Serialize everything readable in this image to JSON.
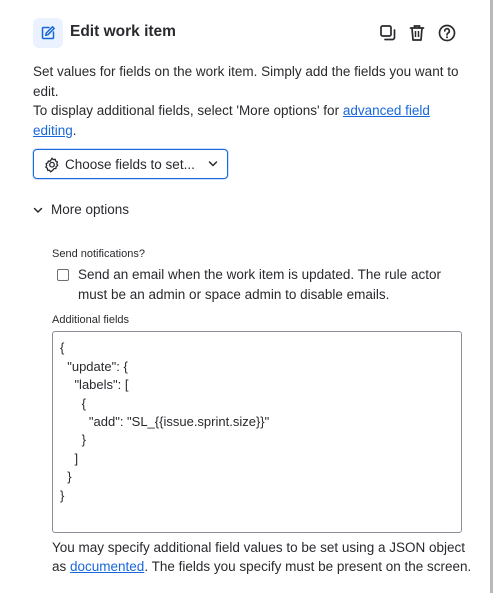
{
  "header": {
    "title": "Edit work item",
    "icons": [
      "edit-icon",
      "copy-icon",
      "trash-icon",
      "help-icon"
    ]
  },
  "description": {
    "line1": "Set values for fields on the work item. Simply add the fields you want to edit.",
    "line2_prefix": "To display additional fields, select 'More options' for ",
    "line2_link": "advanced field editing",
    "line2_suffix": "."
  },
  "choose_fields": {
    "label": "Choose fields to set...",
    "icon": "gear-icon"
  },
  "more_options": {
    "label": "More options",
    "expanded": true
  },
  "notifications": {
    "label": "Send notifications?",
    "checkbox_text": "Send an email when the work item is updated. The rule actor must be an admin or space admin to disable emails.",
    "checked": false
  },
  "additional_fields": {
    "label": "Additional fields",
    "lines": [
      "{",
      "  \"update\": {",
      "    \"labels\": [",
      "      {",
      "        \"add\": \"SL_{{issue.sprint.size}}\"",
      "      }",
      "    ]",
      "  }",
      "}"
    ]
  },
  "help_text": {
    "prefix": "You may specify additional field values to be set using a JSON object as ",
    "link": "documented",
    "suffix": ". The fields you specify must be present on the screen."
  },
  "colors": {
    "accent": "#1868db",
    "text": "#292a2e",
    "badge_bg": "#e9f2fe"
  }
}
